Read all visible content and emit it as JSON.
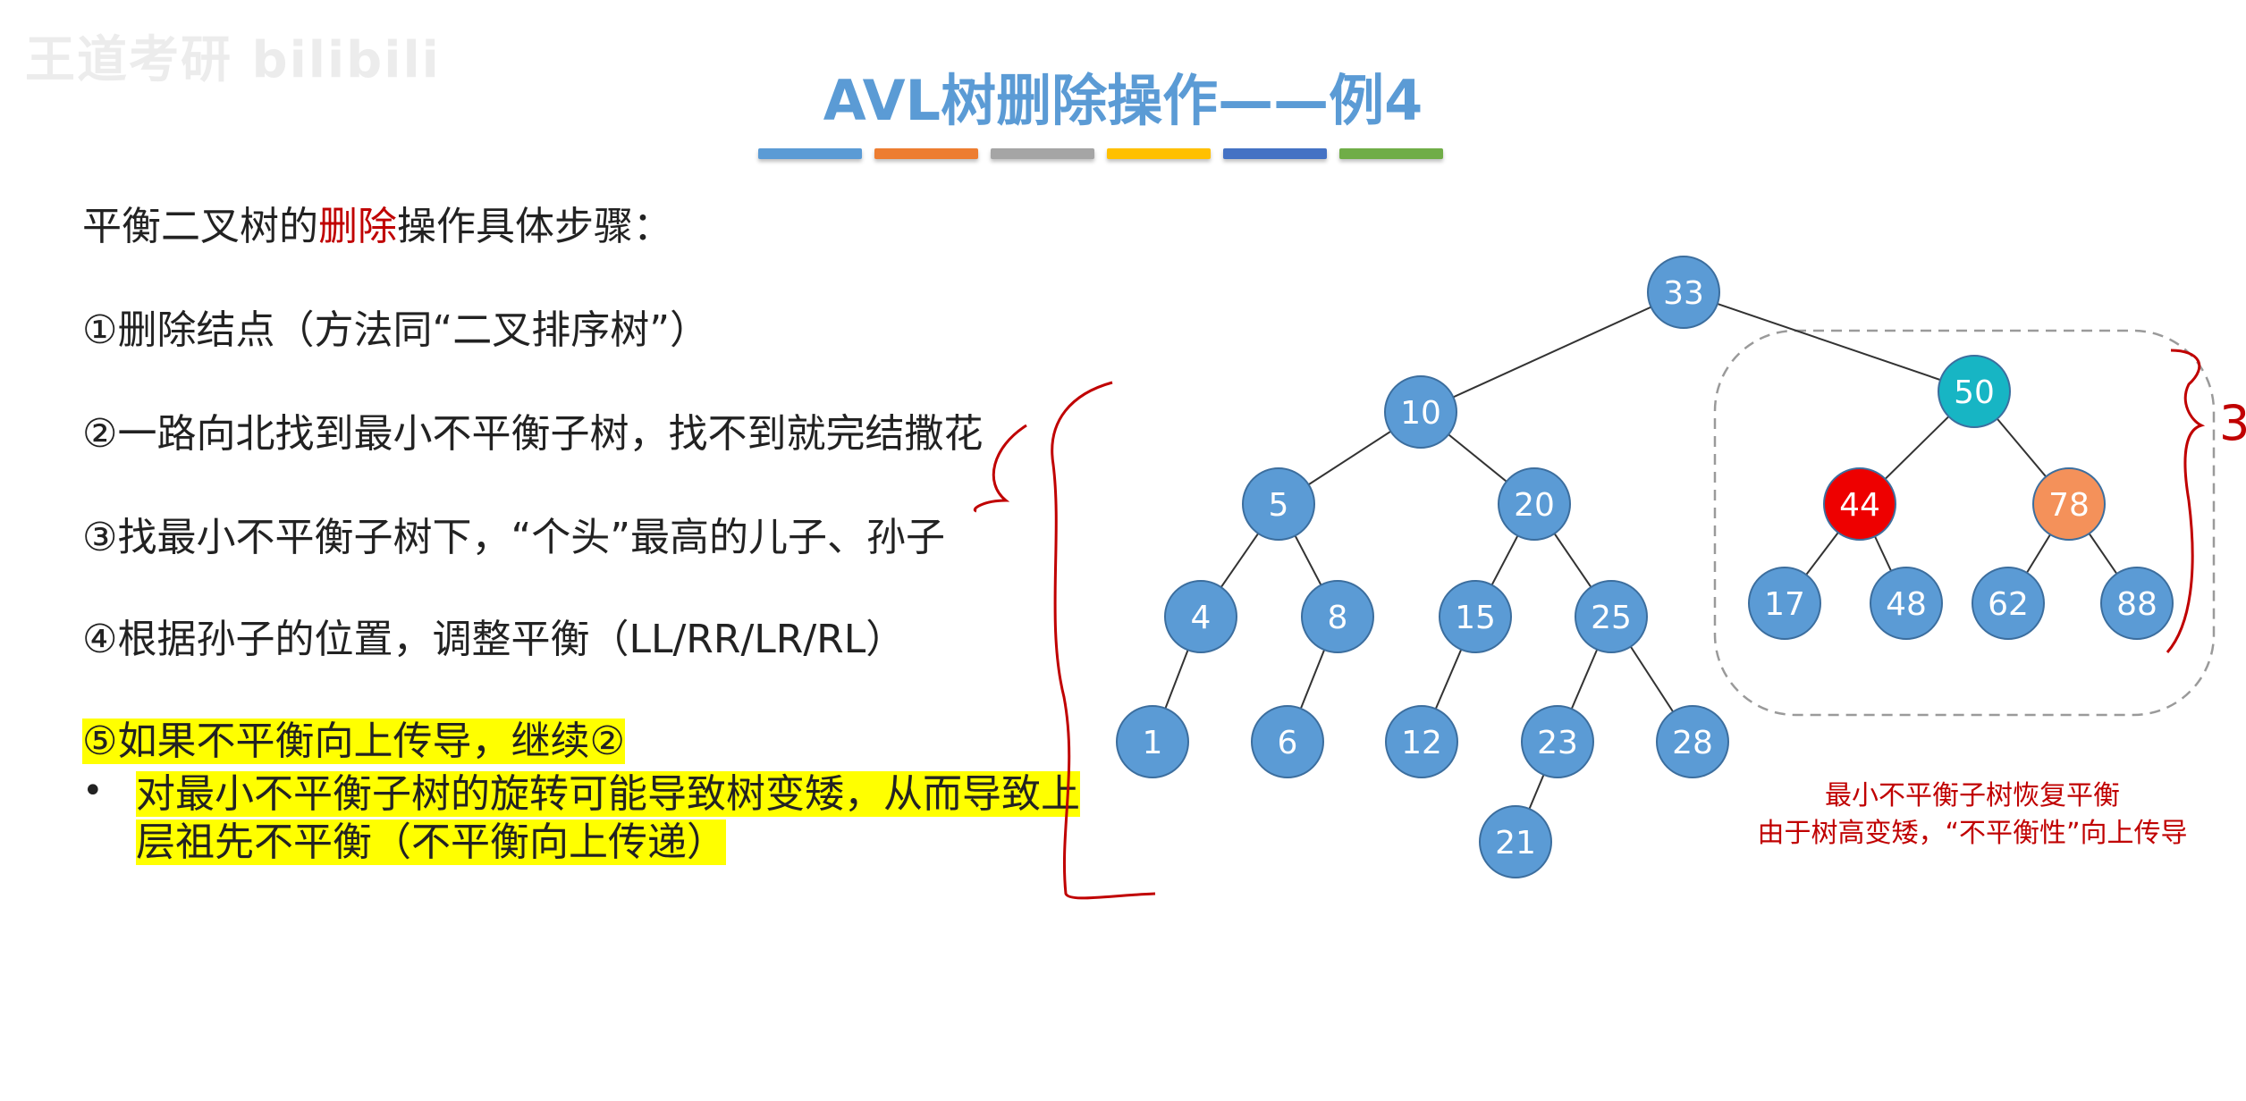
{
  "watermark": "王道考研 bilibili",
  "title": "AVL树删除操作——例4",
  "title_bar_colors": [
    "#5b9bd5",
    "#ed7d31",
    "#a5a5a5",
    "#ffc000",
    "#4472c4",
    "#70ad47"
  ],
  "heading": {
    "pre": "平衡二叉树的",
    "highlight": "删除",
    "post": "操作具体步骤："
  },
  "steps": [
    "①删除结点（方法同“二叉排序树”）",
    "②一路向北找到最小不平衡子树，找不到就完结撒花",
    "③找最小不平衡子树下，“个头”最高的儿子、孙子",
    "④根据孙子的位置，调整平衡（LL/RR/LR/RL）",
    "⑤如果不平衡向上传导，继续②"
  ],
  "bullet": {
    "dot": "•",
    "text": "对最小不平衡子树的旋转可能导致树变矮，从而导致上层祖先不平衡（不平衡向上传递）"
  },
  "tree": {
    "nodes": [
      {
        "id": "33",
        "label": "33",
        "color": "#5b9bd5"
      },
      {
        "id": "10",
        "label": "10",
        "color": "#5b9bd5"
      },
      {
        "id": "50",
        "label": "50",
        "color": "#17b5c4"
      },
      {
        "id": "5",
        "label": "5",
        "color": "#5b9bd5"
      },
      {
        "id": "20",
        "label": "20",
        "color": "#5b9bd5"
      },
      {
        "id": "44",
        "label": "44",
        "color": "#ee0000"
      },
      {
        "id": "78",
        "label": "78",
        "color": "#f4915a"
      },
      {
        "id": "4",
        "label": "4",
        "color": "#5b9bd5"
      },
      {
        "id": "8",
        "label": "8",
        "color": "#5b9bd5"
      },
      {
        "id": "15",
        "label": "15",
        "color": "#5b9bd5"
      },
      {
        "id": "25",
        "label": "25",
        "color": "#5b9bd5"
      },
      {
        "id": "17",
        "label": "17",
        "color": "#5b9bd5"
      },
      {
        "id": "48",
        "label": "48",
        "color": "#5b9bd5"
      },
      {
        "id": "62",
        "label": "62",
        "color": "#5b9bd5"
      },
      {
        "id": "88",
        "label": "88",
        "color": "#5b9bd5"
      },
      {
        "id": "1",
        "label": "1",
        "color": "#5b9bd5"
      },
      {
        "id": "6",
        "label": "6",
        "color": "#5b9bd5"
      },
      {
        "id": "12",
        "label": "12",
        "color": "#5b9bd5"
      },
      {
        "id": "23",
        "label": "23",
        "color": "#5b9bd5"
      },
      {
        "id": "28",
        "label": "28",
        "color": "#5b9bd5"
      },
      {
        "id": "21",
        "label": "21",
        "color": "#5b9bd5"
      }
    ],
    "edges": [
      [
        "33",
        "10"
      ],
      [
        "33",
        "50"
      ],
      [
        "10",
        "5"
      ],
      [
        "10",
        "20"
      ],
      [
        "50",
        "44"
      ],
      [
        "50",
        "78"
      ],
      [
        "5",
        "4"
      ],
      [
        "5",
        "8"
      ],
      [
        "20",
        "15"
      ],
      [
        "20",
        "25"
      ],
      [
        "44",
        "17"
      ],
      [
        "44",
        "48"
      ],
      [
        "78",
        "62"
      ],
      [
        "78",
        "88"
      ],
      [
        "4",
        "1"
      ],
      [
        "8",
        "6"
      ],
      [
        "15",
        "12"
      ],
      [
        "25",
        "23"
      ],
      [
        "25",
        "28"
      ],
      [
        "23",
        "21"
      ]
    ]
  },
  "note_lines": [
    "最小不平衡子树恢复平衡",
    "由于树高变矮，“不平衡性”向上传导"
  ],
  "annotation_mark": "3"
}
